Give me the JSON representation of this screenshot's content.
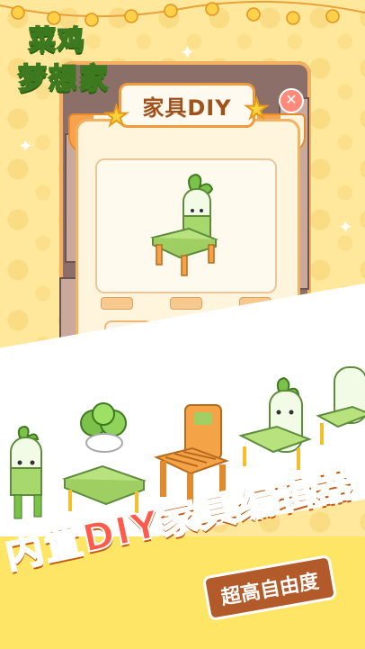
{
  "game": {
    "logo_line1": "菜鸡",
    "logo_line2": "梦想家"
  },
  "diy_panel": {
    "title": "家具DIY",
    "close_icon": "close-icon",
    "tags": [
      "",
      "",
      ""
    ],
    "part_slots": [
      {
        "name": "radish-backrest-part"
      },
      {
        "name": "clover-cushion-part"
      },
      {
        "name": "arch-frame-part"
      }
    ]
  },
  "promo": {
    "slogan_prefix": "内置",
    "slogan_highlight": "DIY",
    "slogan_suffix": "家具编辑器",
    "subtitle": "超高自由度"
  },
  "colors": {
    "background": "#ffe79b",
    "accent_orange": "#f39a3a",
    "panel_cream": "#fff4dc",
    "leaf_green": "#7cc24a",
    "slogan_orange": "#ff8a2a",
    "badge_brown": "#b35a2a"
  }
}
